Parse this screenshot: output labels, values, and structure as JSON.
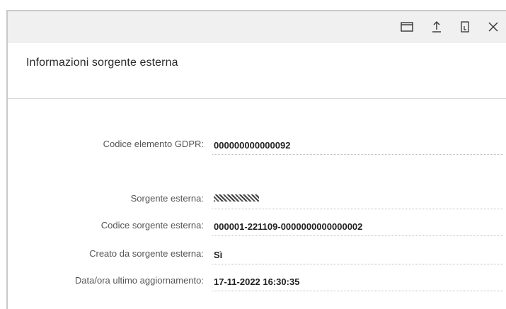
{
  "dialog": {
    "title": "Informazioni sorgente esterna",
    "toolbar_icons": [
      "window-icon",
      "upload-icon",
      "bookmark-icon",
      "close-icon"
    ]
  },
  "fields": [
    {
      "label": "Codice elemento GDPR:",
      "value": "000000000000092"
    },
    {
      "label": "Sorgente esterna:",
      "value": "XXXXXXX",
      "redacted": true
    },
    {
      "label": "Codice sorgente esterna:",
      "value": "000001-221109-0000000000000002"
    },
    {
      "label": "Creato da sorgente esterna:",
      "value": "Sì"
    },
    {
      "label": "Data/ora ultimo aggiornamento:",
      "value": "17-11-2022 16:30:35"
    }
  ]
}
